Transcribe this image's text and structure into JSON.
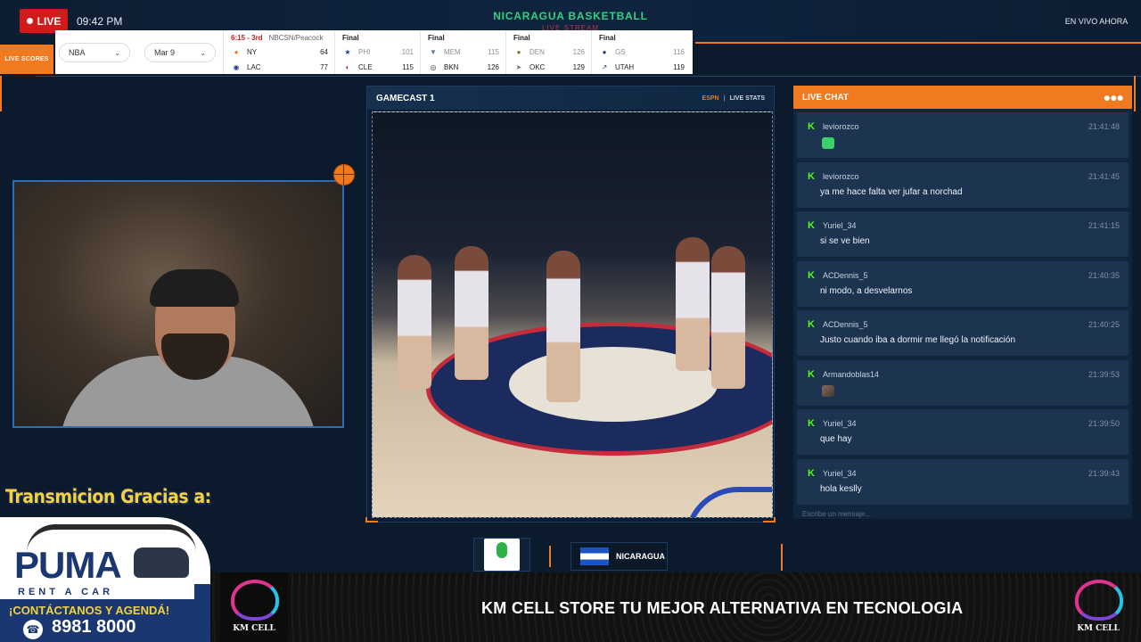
{
  "header": {
    "live_badge": "LIVE",
    "clock": "09:42 PM",
    "stream_title": "NICARAGUA BASKETBALL",
    "stream_subtitle": "LIVE STREAM",
    "status_right": "EN VIVO AHORA"
  },
  "scores": {
    "tab_label": "LIVE SCORES",
    "league_select": "NBA",
    "date_select": "Mar 9",
    "games": [
      {
        "status": "6:15 - 3rd",
        "network": "NBCSN/Peacock",
        "away": {
          "team": "NY",
          "score": "64",
          "logo": "knicks-logo"
        },
        "home": {
          "team": "LAC",
          "score": "77",
          "logo": "clippers-logo"
        }
      },
      {
        "status": "Final",
        "away": {
          "team": "PHI",
          "score": "101",
          "logo": "76ers-logo"
        },
        "home": {
          "team": "CLE",
          "score": "115",
          "logo": "cavaliers-logo"
        }
      },
      {
        "status": "Final",
        "away": {
          "team": "MEM",
          "score": "115",
          "logo": "grizzlies-logo"
        },
        "home": {
          "team": "BKN",
          "score": "126",
          "logo": "nets-logo"
        }
      },
      {
        "status": "Final",
        "away": {
          "team": "DEN",
          "score": "126",
          "logo": "nuggets-logo"
        },
        "home": {
          "team": "OKC",
          "score": "129",
          "logo": "thunder-logo"
        }
      },
      {
        "status": "Final",
        "away": {
          "team": "GS",
          "score": "116",
          "logo": "warriors-logo"
        },
        "home": {
          "team": "UTAH",
          "score": "119",
          "logo": "jazz-logo"
        }
      }
    ]
  },
  "gamecast": {
    "title": "GAMECAST 1",
    "source": "ESPN",
    "separator": "|",
    "stats_link": "LIVE STATS"
  },
  "team_bar": {
    "team_name": "NICARAGUA"
  },
  "chat": {
    "title": "LIVE CHAT",
    "menu_icon": "more-dots-icon",
    "input_placeholder": "Escribe un mensaje...",
    "messages": [
      {
        "user": "leviorozco",
        "time": "21:41:48",
        "text": "",
        "emote": "green-emote"
      },
      {
        "user": "leviorozco",
        "time": "21:41:45",
        "text": "ya me hace falta ver jufar a norchad"
      },
      {
        "user": "Yuriel_34",
        "time": "21:41:15",
        "text": "si se ve bien"
      },
      {
        "user": "ACDennis_5",
        "time": "21:40:35",
        "text": "ni modo, a desvelarnos"
      },
      {
        "user": "ACDennis_5",
        "time": "21:40:25",
        "text": "Justo cuando iba a dormir me llegó la notificación"
      },
      {
        "user": "Armandoblas14",
        "time": "21:39:53",
        "text": "",
        "emote": "photo-emote"
      },
      {
        "user": "Yuriel_34",
        "time": "21:39:50",
        "text": "que hay"
      },
      {
        "user": "Yuriel_34",
        "time": "21:39:43",
        "text": "hola keslly"
      }
    ]
  },
  "sponsor": {
    "heading": "Transmicion Gracias a:",
    "brand": "PUMA",
    "tagline": "RENT A CAR",
    "contact": "¡CONTÁCTANOS Y AGENDÁ!",
    "phone": "8981 8000"
  },
  "banner": {
    "text": "KM CELL STORE TU MEJOR ALTERNATIVA EN TECNOLOGIA",
    "logo_text": "KM CELL"
  },
  "colors": {
    "accent": "#f07a1f",
    "live_red": "#d11a1a",
    "title_green": "#2fd37e",
    "kick_green": "#53fc18"
  }
}
